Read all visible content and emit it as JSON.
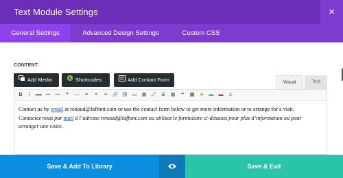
{
  "modal": {
    "title": "Text Module Settings",
    "close_glyph": "×"
  },
  "tabs": [
    {
      "label": "General Settings",
      "active": true
    },
    {
      "label": "Advanced Design Settings",
      "active": false
    },
    {
      "label": "Custom CSS",
      "active": false
    }
  ],
  "content": {
    "label": "CONTENT:",
    "buttons": {
      "add_media": {
        "label": "Add Media",
        "icon": "media-icon"
      },
      "shortcodes": {
        "label": "Shortcodes",
        "icon": "shortcodes-icon"
      },
      "contact_form": {
        "label": "Add Contact Form",
        "icon": "contact-form-icon"
      }
    },
    "editor_tabs": {
      "visual": "Visual",
      "text": "Text"
    },
    "toolbar": [
      "B",
      "I",
      "ABC",
      "≔",
      "≔",
      "❝",
      "—",
      "≡",
      "≡",
      "≡",
      "🔗",
      "⛓",
      "▭",
      "▦",
      "⤢",
      "≣",
      "▦",
      "❝",
      "▦",
      "■",
      "▬",
      "▬",
      "♙"
    ],
    "paragraph1": {
      "before": "Contact us by ",
      "link": "email",
      "after": " at renaud@laffont.com or use the contact form below to get more information or to arrange for a visit."
    },
    "paragraph2": {
      "before": "Contactez nous par ",
      "link": "mail",
      "after": " à l’adresse renaud@laffont.com ou utilisez le formulaire ci-dessous pour plus d’information ou pour arranger une visite."
    }
  },
  "footer": {
    "save_library": "Save & Add To Library",
    "preview_icon": "eye-icon",
    "save_exit": "Save & Exit"
  },
  "colors": {
    "header": "#6c2eb9",
    "tabs_bar": "#7e3bd0",
    "active_tab": "#8f42ec",
    "save_library": "#0c8ee0",
    "preview": "#0e7ab9",
    "save_exit": "#29c4a9"
  }
}
